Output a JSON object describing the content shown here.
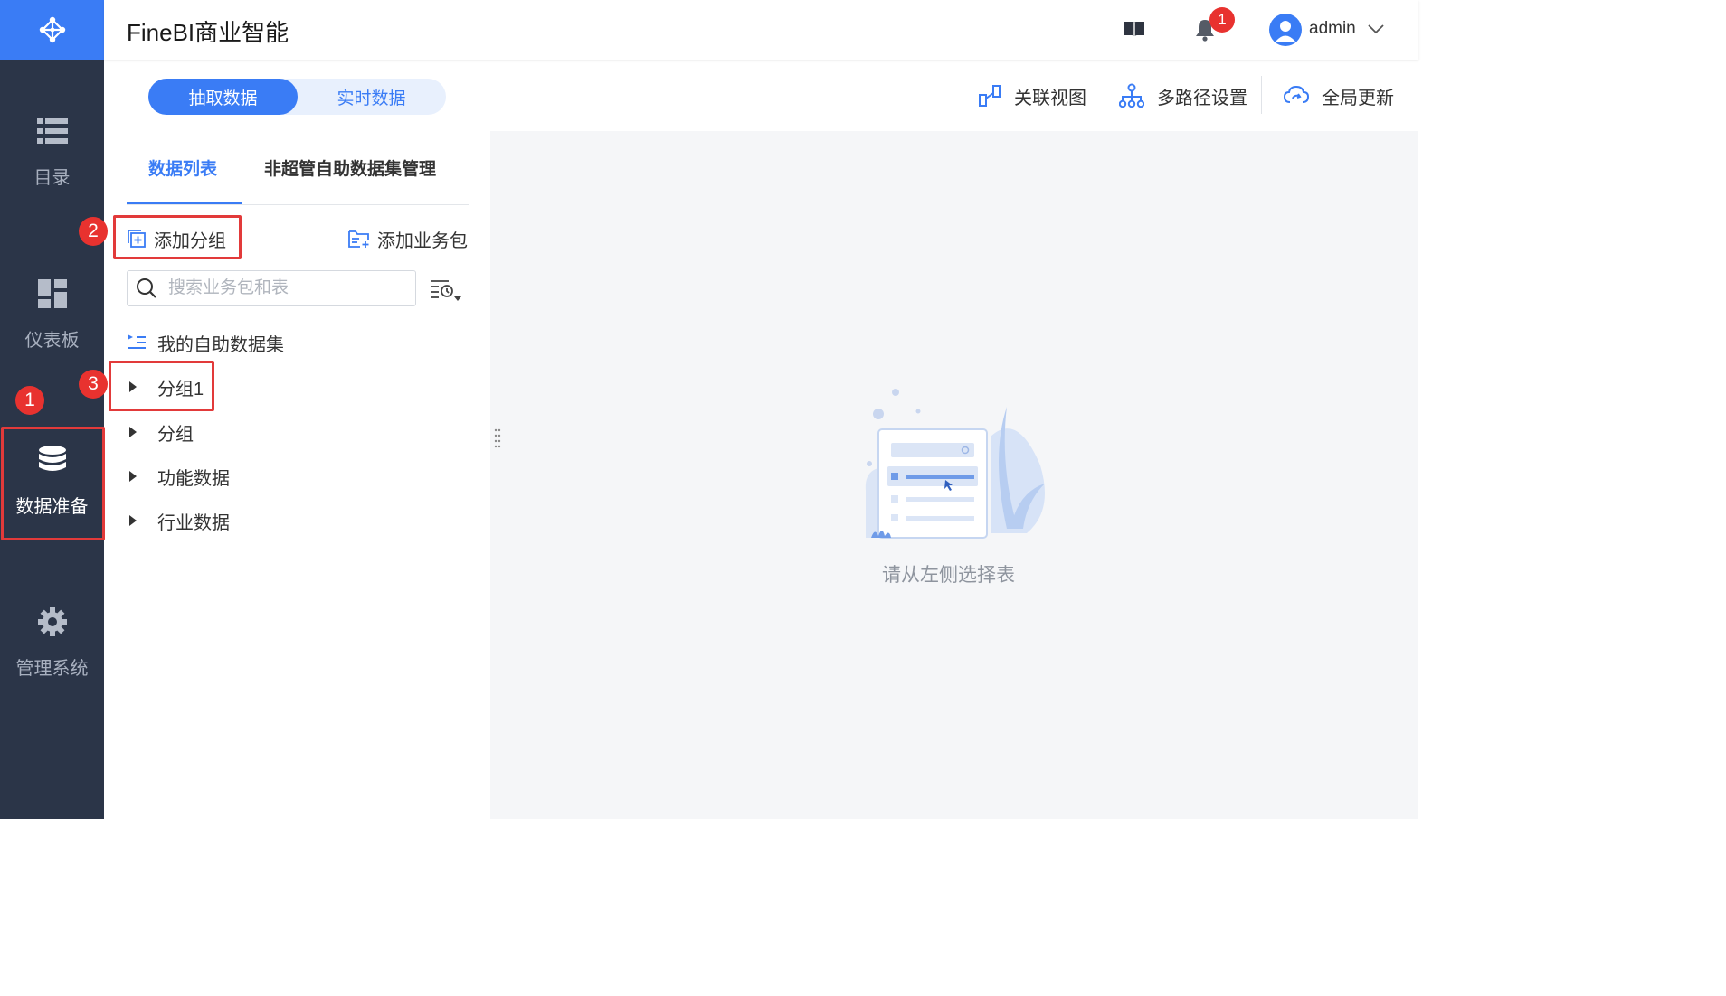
{
  "header": {
    "app_title": "FineBI商业智能",
    "notification_count": "1",
    "user_name": "admin"
  },
  "nav": {
    "items": [
      {
        "label": "目录",
        "icon": "list-icon"
      },
      {
        "label": "仪表板",
        "icon": "dashboard-icon"
      },
      {
        "label": "数据准备",
        "icon": "database-icon"
      },
      {
        "label": "管理系统",
        "icon": "gear-icon"
      }
    ],
    "active": "数据准备"
  },
  "toolbar": {
    "segments": [
      "抽取数据",
      "实时数据"
    ],
    "active_segment": "抽取数据",
    "related_view": "关联视图",
    "multipath_settings": "多路径设置",
    "global_update": "全局更新"
  },
  "left_panel": {
    "tabs": [
      "数据列表",
      "非超管自助数据集管理"
    ],
    "active_tab": "数据列表",
    "add_group": "添加分组",
    "add_package": "添加业务包",
    "search_placeholder": "搜索业务包和表",
    "my_dataset": "我的自助数据集",
    "groups": [
      "分组1",
      "分组",
      "功能数据",
      "行业数据"
    ]
  },
  "empty_state": {
    "message": "请从左侧选择表"
  },
  "annotations": {
    "markers": [
      "1",
      "2",
      "3"
    ]
  },
  "colors": {
    "accent": "#3a7cf5",
    "nav_bg": "#2b3548",
    "marker_red": "#e8322f",
    "content_bg": "#f5f6f8"
  }
}
